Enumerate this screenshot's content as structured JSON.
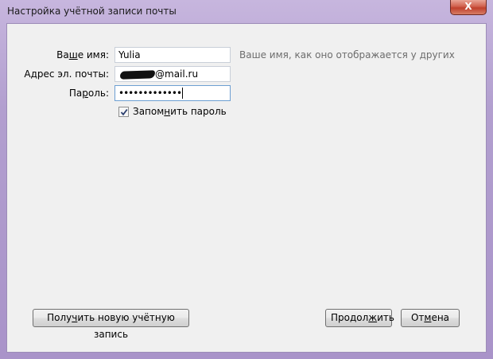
{
  "window": {
    "title": "Настройка учётной записи почты",
    "close_glyph": "X"
  },
  "form": {
    "name_label": "Ваше имя:",
    "name_value": "Yulia",
    "name_hint": "Ваше имя, как оно отображается у других",
    "email_label": "Адрес эл. почты:",
    "email_value": "@mail.ru",
    "password_label": "Пароль:",
    "password_value": "•••••••••••••",
    "remember_label": "Запомнить пароль",
    "remember_checked": true
  },
  "buttons": {
    "new_account": "Получить новую учётную запись",
    "continue": "Продолжить",
    "cancel": "Отмена"
  }
}
